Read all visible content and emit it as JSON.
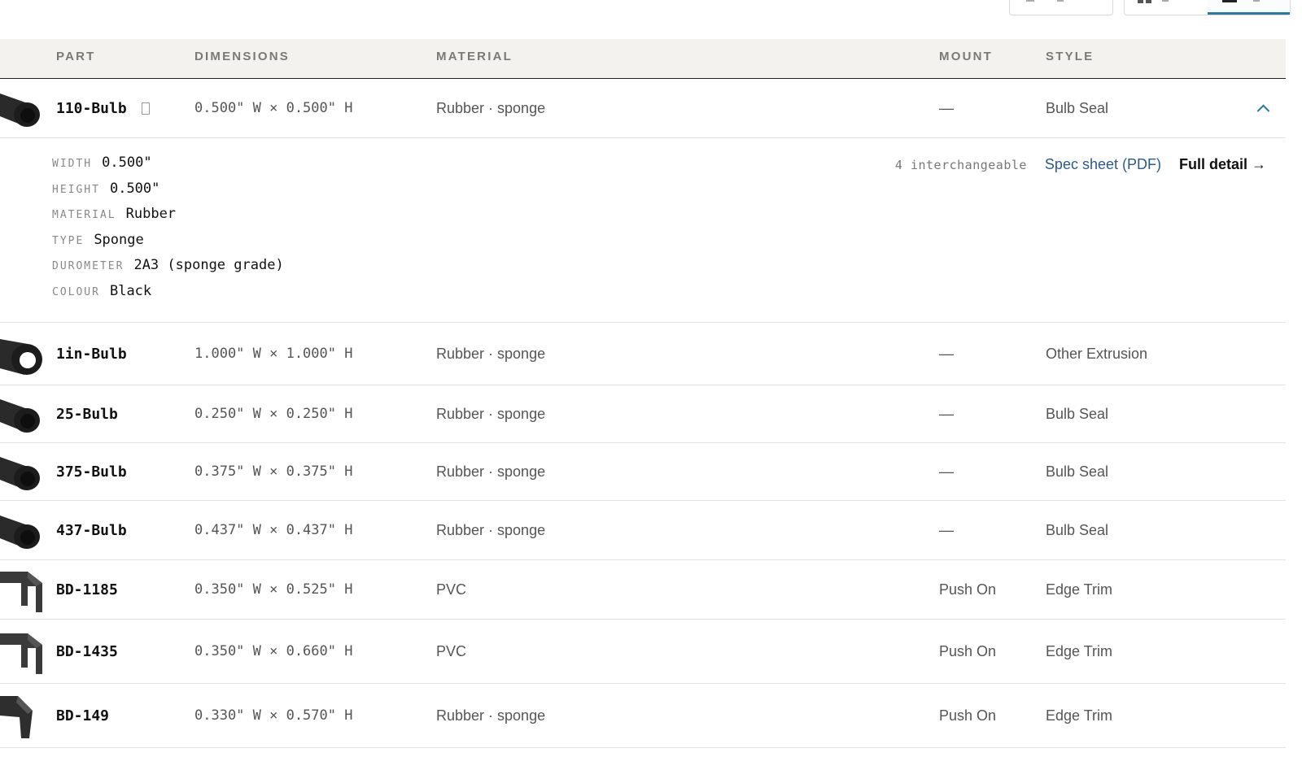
{
  "toolbar": {
    "sort_button": "sort",
    "view_grid": "grid view",
    "view_list": "list view"
  },
  "columns": [
    "PART",
    "DIMENSIONS",
    "MATERIAL",
    "MOUNT",
    "STYLE"
  ],
  "rows": [
    {
      "part": "110-Bulb",
      "dims": "0.500\" W × 0.500\" H",
      "material": "Rubber · sponge",
      "mount": "—",
      "style": "Bulb Seal",
      "thumb": "bulb-tube-icon"
    },
    {
      "part": "1in-Bulb",
      "dims": "1.000\" W × 1.000\" H",
      "material": "Rubber · sponge",
      "mount": "—",
      "style": "Other Extrusion",
      "thumb": "large-bulb-icon"
    },
    {
      "part": "25-Bulb",
      "dims": "0.250\" W × 0.250\" H",
      "material": "Rubber · sponge",
      "mount": "—",
      "style": "Bulb Seal",
      "thumb": "bulb-tube-icon"
    },
    {
      "part": "375-Bulb",
      "dims": "0.375\" W × 0.375\" H",
      "material": "Rubber · sponge",
      "mount": "—",
      "style": "Bulb Seal",
      "thumb": "bulb-tube-icon"
    },
    {
      "part": "437-Bulb",
      "dims": "0.437\" W × 0.437\" H",
      "material": "Rubber · sponge",
      "mount": "—",
      "style": "Bulb Seal",
      "thumb": "bulb-tube-icon"
    },
    {
      "part": "BD-1185",
      "dims": "0.350\" W × 0.525\" H",
      "material": "PVC",
      "mount": "Push On",
      "style": "Edge Trim",
      "thumb": "u-channel-icon"
    },
    {
      "part": "BD-1435",
      "dims": "0.350\" W × 0.660\" H",
      "material": "PVC",
      "mount": "Push On",
      "style": "Edge Trim",
      "thumb": "u-channel-icon"
    },
    {
      "part": "BD-149",
      "dims": "0.330\" W × 0.570\" H",
      "material": "Rubber · sponge",
      "mount": "Push On",
      "style": "Edge Trim",
      "thumb": "v-trim-icon"
    }
  ],
  "expanded": {
    "specs": [
      {
        "key": "WIDTH",
        "value": "0.500\""
      },
      {
        "key": "HEIGHT",
        "value": "0.500\""
      },
      {
        "key": "MATERIAL",
        "value": "Rubber"
      },
      {
        "key": "TYPE",
        "value": "Sponge"
      },
      {
        "key": "DUROMETER",
        "value": "2A3 (sponge grade)"
      },
      {
        "key": "COLOUR",
        "value": "Black"
      }
    ],
    "interchangeable": "4 interchangeable",
    "spec_sheet": "Spec sheet (PDF)",
    "full_detail": "Full detail →"
  },
  "colors": {
    "accent": "#2b7a9e",
    "link": "#2c5a8a",
    "header_bg": "#f3f2ef"
  }
}
